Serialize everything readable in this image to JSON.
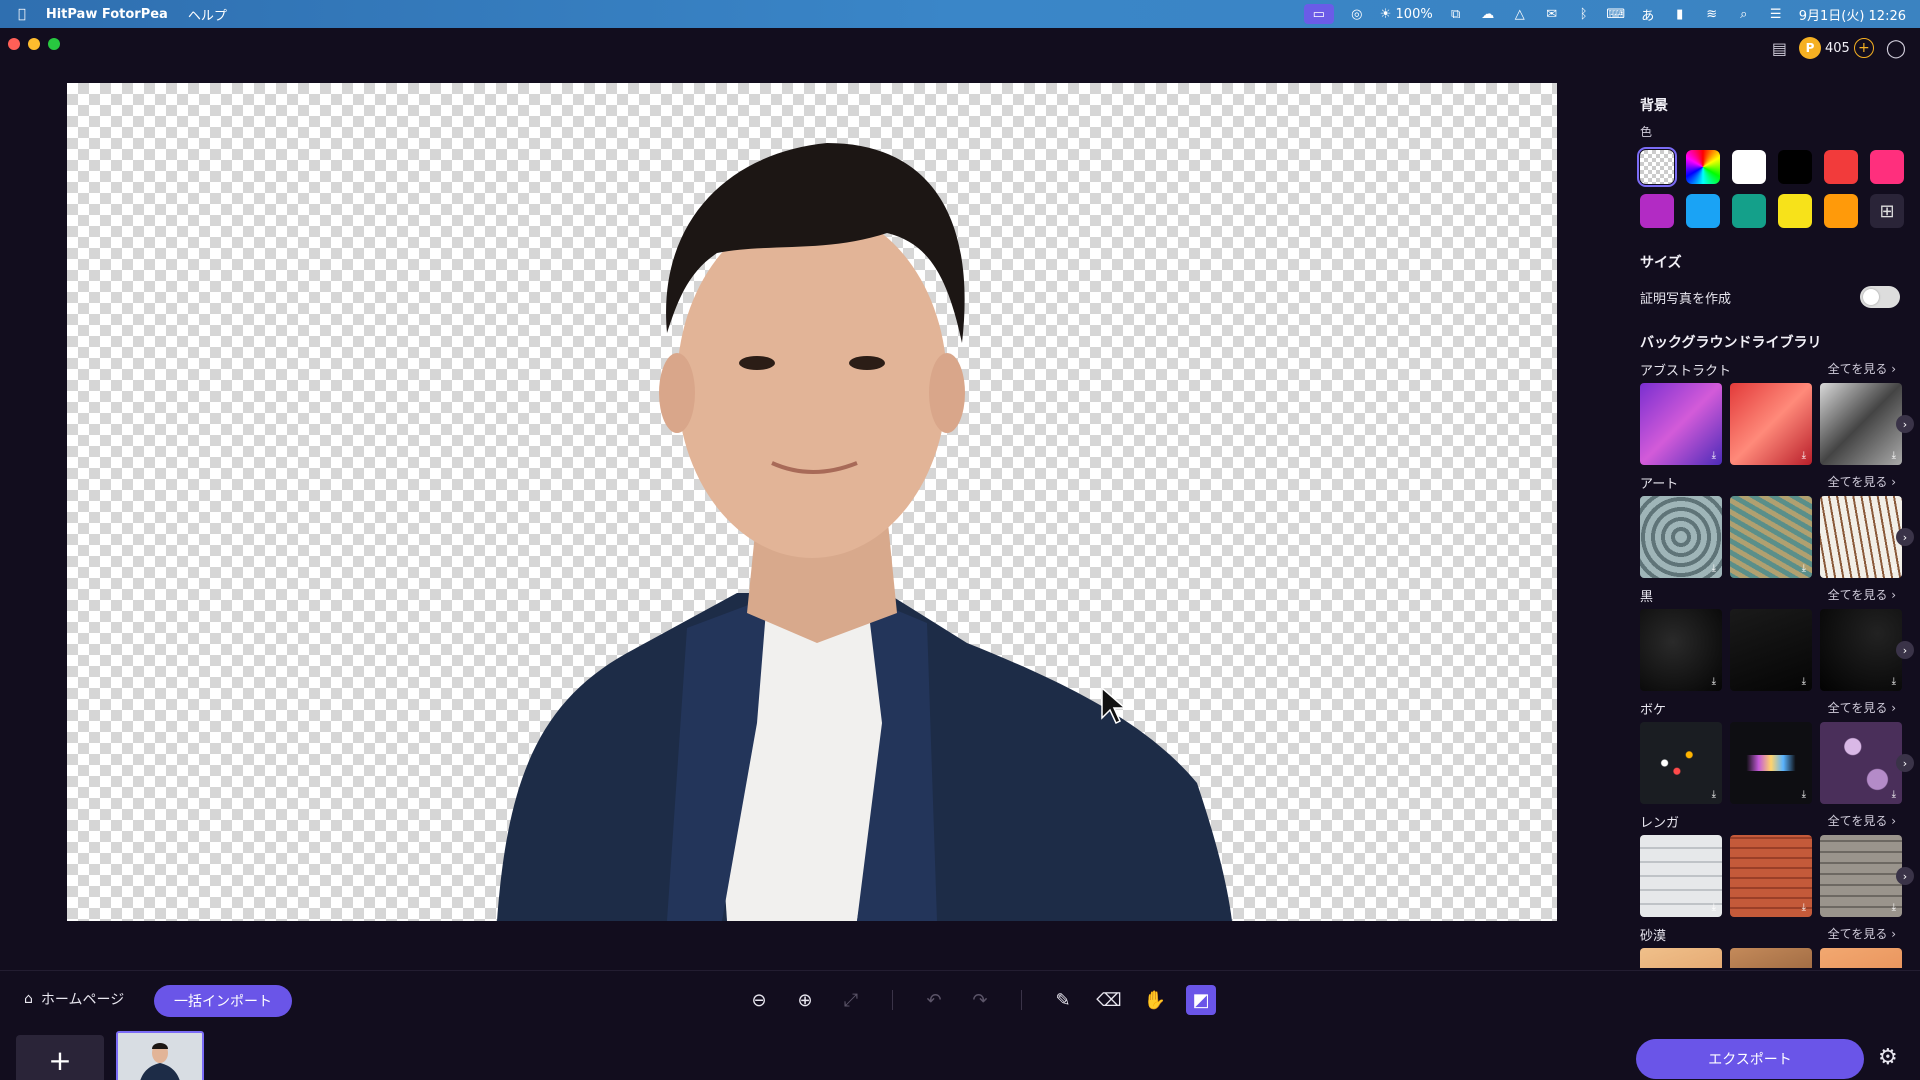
{
  "menubar": {
    "app_name": "HitPaw FotorPea",
    "menu_help": "ヘルプ",
    "brightness": "100%",
    "datetime": "9月1日(火) 12:26"
  },
  "topbar": {
    "credits": "405"
  },
  "panel": {
    "background_title": "背景",
    "color_label": "色",
    "swatches": [
      "transparent",
      "rainbow",
      "#ffffff",
      "#000000",
      "#f23b3b",
      "#ff2f7d",
      "#b22bc4",
      "#1aa3f5",
      "#14a08a",
      "#f7e21a",
      "#ff9a0a",
      "add-image"
    ],
    "size_title": "サイズ",
    "id_photo_label": "証明写真を作成",
    "id_photo_enabled": false,
    "library_title": "バックグラウンドライブラリ",
    "see_all": "全てを見る",
    "categories": [
      {
        "name": "アブストラクト"
      },
      {
        "name": "アート"
      },
      {
        "name": "黒"
      },
      {
        "name": "ボケ"
      },
      {
        "name": "レンガ"
      },
      {
        "name": "砂漠"
      }
    ]
  },
  "bottom": {
    "home_label": "ホームページ",
    "batch_import_label": "一括インポート",
    "export_label": "エクスポート"
  },
  "colors": {
    "accent": "#6a55e8",
    "background": "#120d1e"
  }
}
